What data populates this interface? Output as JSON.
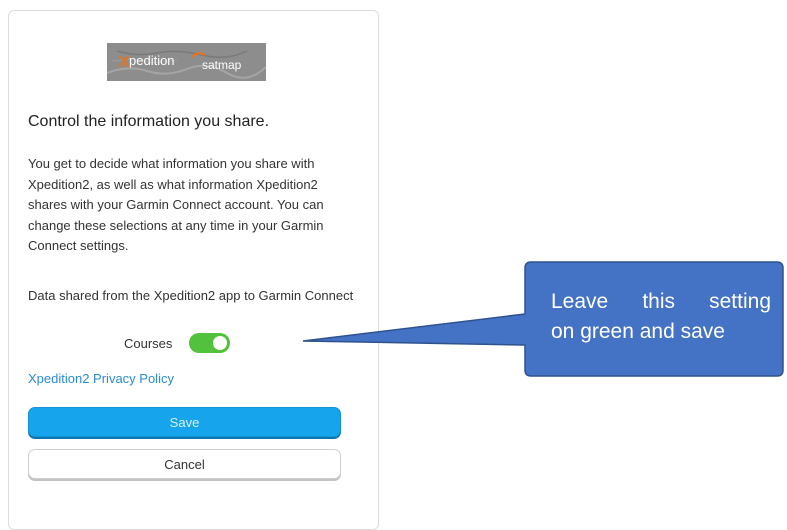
{
  "logo": {
    "primary_text": "Xpedition",
    "secondary_text": "satmap",
    "colors": {
      "orange": "#e8731e",
      "panel": "#8d8d8d"
    }
  },
  "heading": "Control the information you share.",
  "description": "You get to decide what information you share with Xpedition2, as well as what information Xpedition2 shares with your Garmin Connect account. You can change these selections at any time in your Garmin Connect settings.",
  "data_shared_label": "Data shared from the Xpedition2 app to Garmin Connect",
  "toggle": {
    "label": "Courses",
    "state": "on",
    "color": "#52c23c"
  },
  "privacy_link": "Xpedition2 Privacy Policy",
  "buttons": {
    "save": "Save",
    "cancel": "Cancel"
  },
  "callout": {
    "line1_words": [
      "Leave",
      "this",
      "setting"
    ],
    "line2": "on green and save",
    "fill": "#4472c4",
    "border": "#2f528f"
  }
}
